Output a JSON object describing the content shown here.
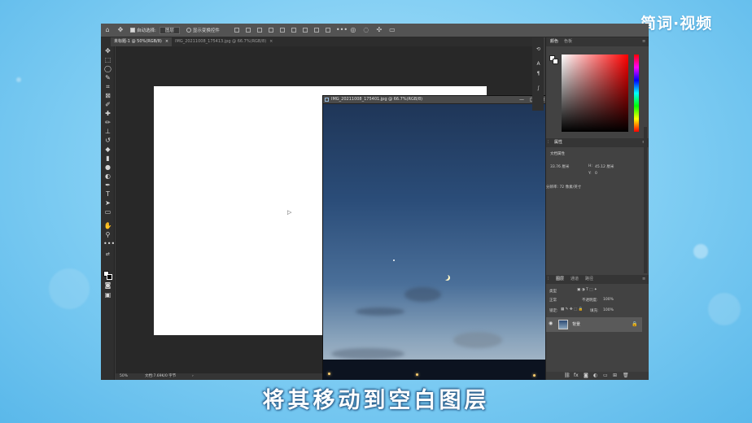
{
  "brand": {
    "logo": "简词·视频"
  },
  "subtitle": "将其移动到空白图层",
  "photoshop": {
    "options_bar": {
      "auto_select_label": "自动选择:",
      "auto_select_value": "图层",
      "show_transform_label": "显示变换控件"
    },
    "tabs": [
      {
        "label": "未标题-1 @ 50%(RGB/8)",
        "close": "×",
        "active": true
      },
      {
        "label": "IMG_20211008_175413.jpg @ 66.7%(RGB/8)",
        "close": "×",
        "active": false
      }
    ],
    "float_window": {
      "title": "IMG_20211008_175401.jpg @ 66.7%(RGB/8)",
      "min": "—",
      "max": "□",
      "close": "×"
    },
    "status": {
      "zoom": "50%",
      "doc_info": "文档:7.69K/0 字节"
    },
    "panels": {
      "color_tabs": [
        "颜色",
        "色板"
      ],
      "properties_tabs": [
        "属性"
      ],
      "properties_title": "文档属性",
      "props": {
        "width": "33.76 厘米",
        "height_label": "H:",
        "height": "45.12 厘米",
        "x_label": "X:",
        "x": "",
        "y_label": "Y:",
        "y": "0",
        "resolution": "分辨率: 72 像素/英寸"
      },
      "layers_tabs": [
        "图层",
        "通道",
        "路径"
      ],
      "layers_filter": "类型",
      "blend_mode": "正常",
      "opacity_label": "不透明度:",
      "opacity_value": "100%",
      "lock_label": "锁定:",
      "fill_label": "填充:",
      "fill_value": "100%",
      "layer": {
        "name": "背景",
        "locked": true
      }
    }
  }
}
